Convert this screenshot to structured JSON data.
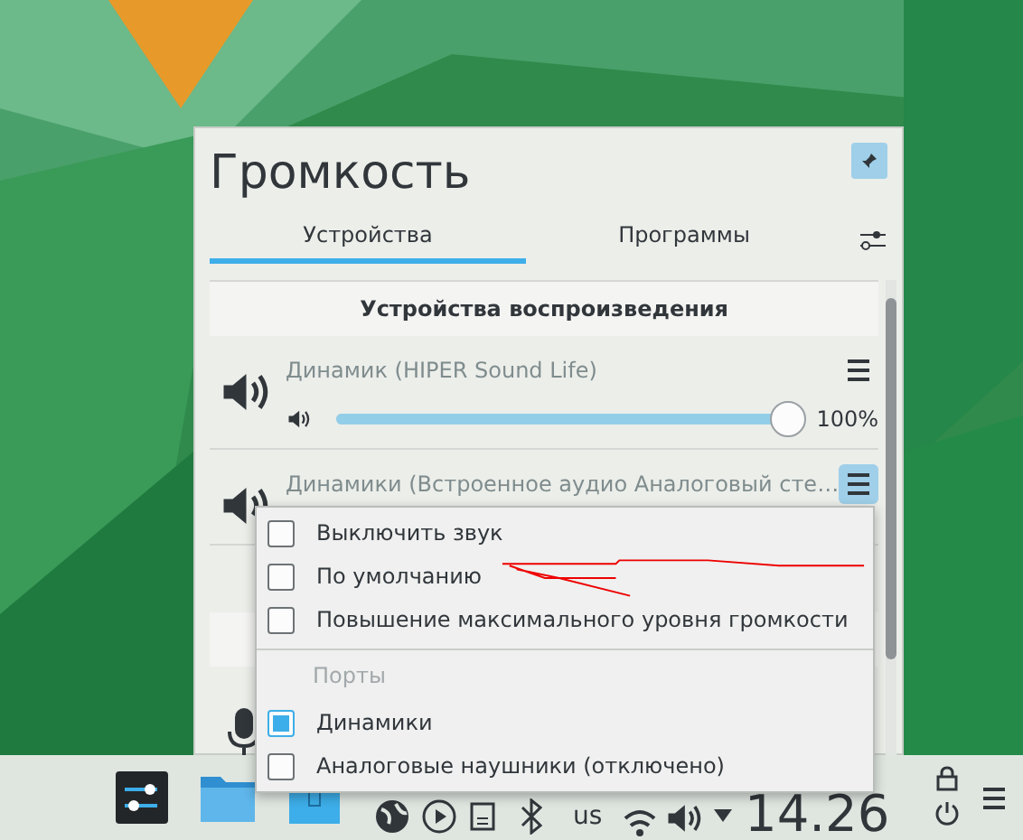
{
  "panel": {
    "title": "Громкость",
    "tabs": [
      {
        "label": "Устройства",
        "selected": true
      },
      {
        "label": "Программы",
        "selected": false
      }
    ],
    "section": "Устройства воспроизведения",
    "devices": [
      {
        "name": "Динамик (HIPER Sound Life)",
        "menu_open": false,
        "level": 1,
        "reading": "100%"
      },
      {
        "name": "Динамики (Встроенное аудио Аналоговый сте…",
        "menu_open": true
      }
    ]
  },
  "menu": {
    "options": [
      {
        "label": "Выключить звук",
        "checked": false
      },
      {
        "label": "По умолчанию",
        "checked": false
      },
      {
        "label": "Повышение максимального уровня громкости",
        "checked": false
      }
    ],
    "ports_header": "Порты",
    "ports": [
      {
        "label": "Динамики",
        "selected": true
      },
      {
        "label": "Аналоговые наушники (отключено)",
        "selected": false
      }
    ]
  },
  "taskbar": {
    "keyboard_layout": "us",
    "clock": "14.26"
  }
}
